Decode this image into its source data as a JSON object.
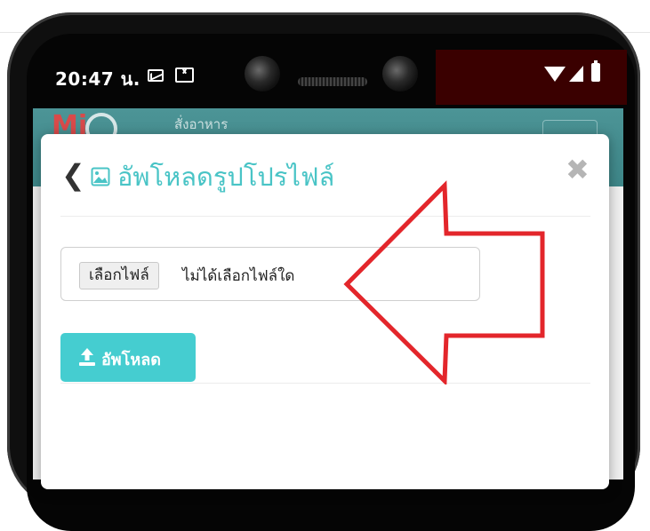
{
  "status_bar": {
    "time": "20:47 น.",
    "icons": [
      "mail-icon",
      "gmail-icon",
      "wifi-icon",
      "signal-icon",
      "battery-icon"
    ]
  },
  "app": {
    "logo_text": "Mi",
    "menu_text": "สั่งอาหาร"
  },
  "modal": {
    "title": "อัพโหลดรูปโปรไฟล์",
    "back_icon": "chevron-left-icon",
    "title_icon": "image-icon",
    "close_icon": "close-icon",
    "close_symbol": "✖",
    "back_symbol": "❮"
  },
  "file_input": {
    "button_label": "เลือกไฟล์",
    "status_text": "ไม่ได้เลือกไฟล์ใด"
  },
  "upload_button": {
    "label": "อัพโหลด",
    "icon": "upload-icon"
  },
  "annotation": {
    "type": "arrow",
    "direction": "left",
    "color": "#e3262b"
  },
  "colors": {
    "accent": "#45cdd0",
    "title": "#49c4c6",
    "header": "#4c9496"
  }
}
